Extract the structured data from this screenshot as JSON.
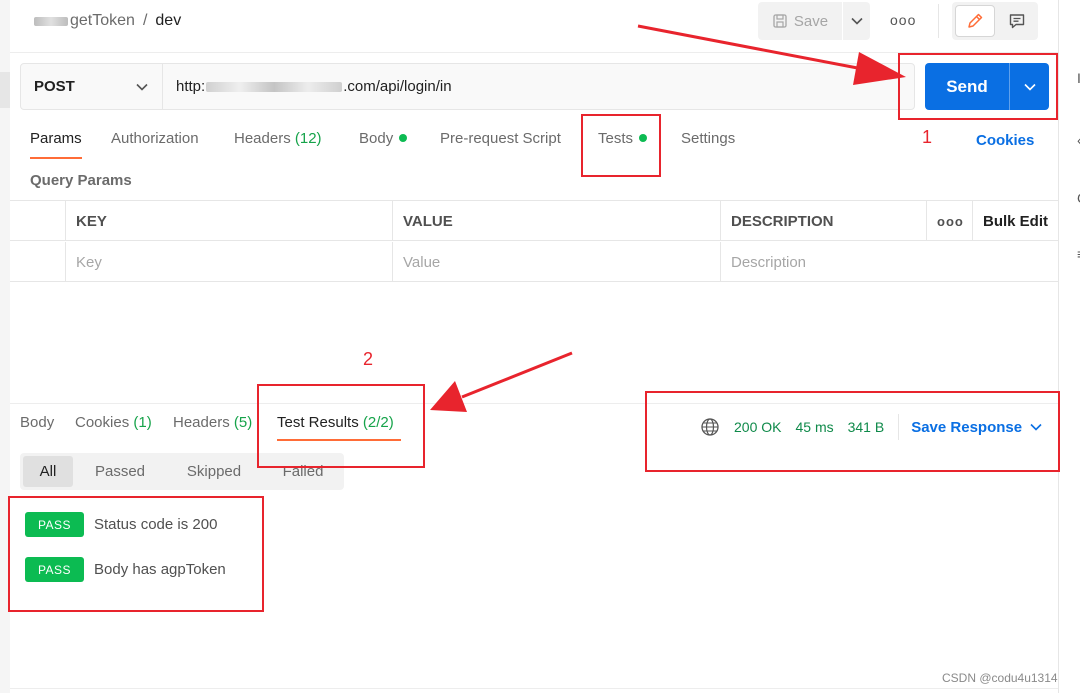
{
  "header": {
    "breadcrumb_collection": "getToken",
    "breadcrumb_separator": "/",
    "breadcrumb_request": "dev",
    "save_label": "Save",
    "more_label": "ooo"
  },
  "request": {
    "method": "POST",
    "url_prefix": "http:",
    "url_suffix": ".com/api/login/in",
    "send_label": "Send"
  },
  "request_tabs": {
    "params": "Params",
    "authorization": "Authorization",
    "headers": "Headers",
    "headers_count": "(12)",
    "body": "Body",
    "prerequest": "Pre-request Script",
    "tests": "Tests",
    "settings": "Settings",
    "cookies": "Cookies"
  },
  "query_params": {
    "title": "Query Params",
    "columns": {
      "key": "KEY",
      "value": "VALUE",
      "description": "DESCRIPTION",
      "more": "ooo",
      "bulk_edit": "Bulk Edit"
    },
    "placeholders": {
      "key": "Key",
      "value": "Value",
      "description": "Description"
    }
  },
  "response_tabs": {
    "body": "Body",
    "cookies": "Cookies",
    "cookies_count": "(1)",
    "headers": "Headers",
    "headers_count": "(5)",
    "test_results": "Test Results",
    "test_results_count": "(2/2)"
  },
  "status": {
    "code": "200 OK",
    "time": "45 ms",
    "size": "341 B",
    "save_response": "Save Response"
  },
  "filters": [
    "All",
    "Passed",
    "Skipped",
    "Failed"
  ],
  "results": [
    {
      "badge": "PASS",
      "text": "Status code is 200"
    },
    {
      "badge": "PASS",
      "text": "Body has agpToken"
    }
  ],
  "annotations": {
    "label_1": "1",
    "label_2": "2",
    "color": "#e8242d"
  },
  "watermark": "CSDN @codu4u1314"
}
